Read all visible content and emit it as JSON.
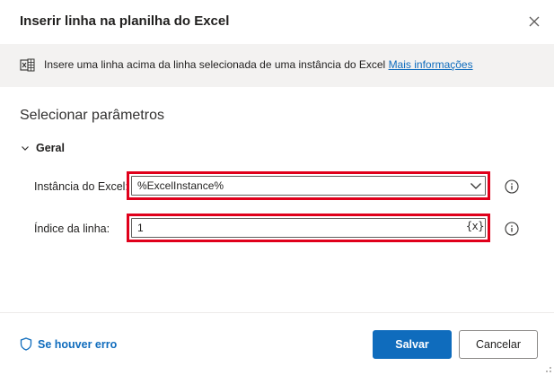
{
  "dialog": {
    "title": "Inserir linha na planilha do Excel",
    "close_icon": "close-icon"
  },
  "info": {
    "icon": "excel-icon",
    "text": "Insere uma linha acima da linha selecionada de uma instância do Excel ",
    "link": "Mais informações"
  },
  "section": {
    "title": "Selecionar parâmetros"
  },
  "group": {
    "label": "Geral",
    "expanded": true
  },
  "fields": {
    "instance": {
      "label": "Instância do Excel:",
      "value": "%ExcelInstance%"
    },
    "index": {
      "label": "Índice da linha:",
      "value": "1",
      "var_button": "{x}"
    }
  },
  "footer": {
    "on_error": "Se houver erro",
    "save": "Salvar",
    "cancel": "Cancelar"
  },
  "colors": {
    "accent": "#0f6cbd",
    "highlight": "#e0001b",
    "info_bg": "#f3f2f1"
  }
}
